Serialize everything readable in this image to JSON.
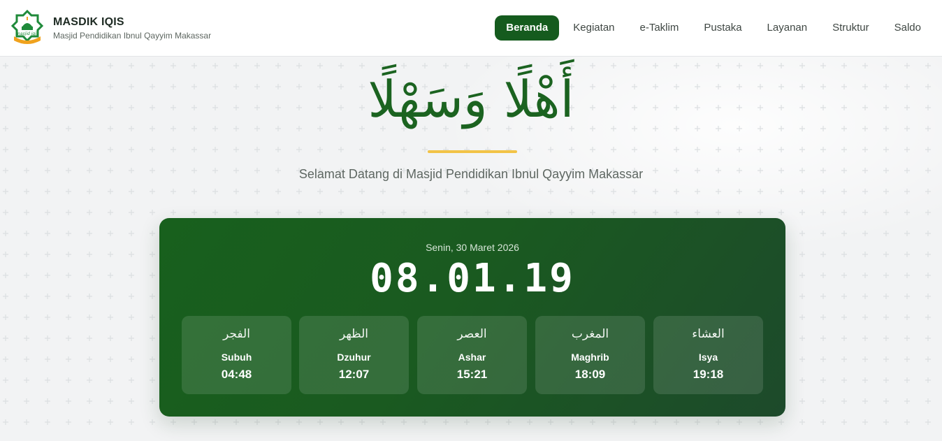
{
  "brand": {
    "title": "MASDIK IQIS",
    "subtitle": "Masjid Pendidikan Ibnul Qayyim Makassar",
    "logo_text": "masjid iqis"
  },
  "nav": {
    "items": [
      {
        "label": "Beranda",
        "active": true
      },
      {
        "label": "Kegiatan",
        "active": false
      },
      {
        "label": "e-Taklim",
        "active": false
      },
      {
        "label": "Pustaka",
        "active": false
      },
      {
        "label": "Layanan",
        "active": false
      },
      {
        "label": "Struktur",
        "active": false
      },
      {
        "label": "Saldo",
        "active": false
      }
    ]
  },
  "hero": {
    "arabic_greeting": "أَهْلًا وَسَهْلًا",
    "welcome": "Selamat Datang di Masjid Pendidikan Ibnul Qayyim Makassar"
  },
  "schedule": {
    "date": "Senin, 30 Maret 2026",
    "clock": "08.01.19",
    "prayers": [
      {
        "arabic": "الفجر",
        "name": "Subuh",
        "time": "04:48"
      },
      {
        "arabic": "الظهر",
        "name": "Dzuhur",
        "time": "12:07"
      },
      {
        "arabic": "العصر",
        "name": "Ashar",
        "time": "15:21"
      },
      {
        "arabic": "المغرب",
        "name": "Maghrib",
        "time": "18:09"
      },
      {
        "arabic": "العشاء",
        "name": "Isya",
        "time": "19:18"
      }
    ]
  },
  "colors": {
    "primary": "#155b1e",
    "accent": "#f2c347",
    "logo_green": "#1f8a3a",
    "logo_orange": "#f0a21d"
  },
  "icons": {
    "logo": "mosque-logo-icon"
  }
}
